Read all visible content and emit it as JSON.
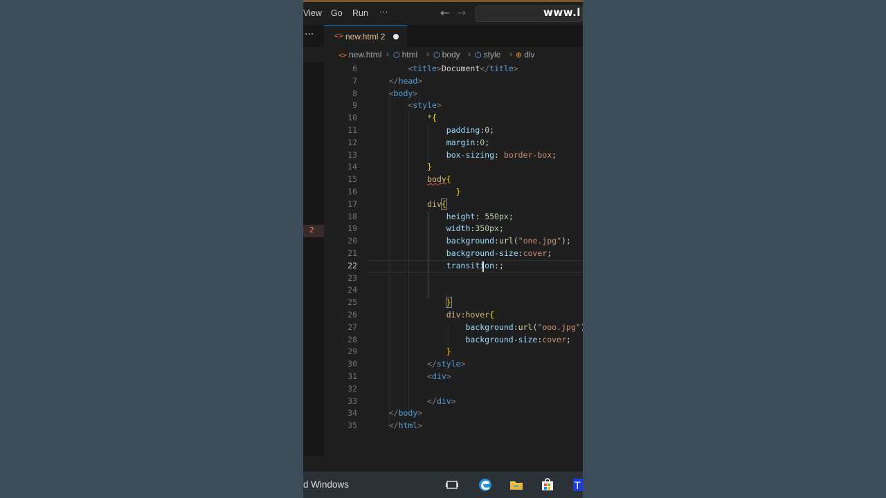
{
  "menu": {
    "items": [
      "View",
      "Go",
      "Run",
      "···"
    ],
    "back": "←",
    "forward": "→",
    "watermark": "www.l"
  },
  "tab": {
    "overflow": "···",
    "icon": "<>",
    "label": "new.html",
    "problems": "2"
  },
  "breadcrumb": {
    "items": [
      "new.html",
      "html",
      "body",
      "style",
      "div"
    ]
  },
  "gutter": {
    "error_count": "2"
  },
  "editor": {
    "current_line": 22,
    "lines": [
      {
        "n": "6",
        "html": "        <span class='t-tag'>&lt;</span><span class='t-name'>title</span><span class='t-tag'>&gt;</span><span class='t-text'>Document</span><span class='t-tag'>&lt;/</span><span class='t-name'>title</span><span class='t-tag'>&gt;</span>"
      },
      {
        "n": "7",
        "html": "    <span class='t-tag'>&lt;/</span><span class='t-name'>head</span><span class='t-tag'>&gt;</span>"
      },
      {
        "n": "8",
        "html": "    <span class='t-tag'>&lt;</span><span class='t-name'>body</span><span class='t-tag'>&gt;</span>"
      },
      {
        "n": "9",
        "html": "        <span class='t-tag'>&lt;</span><span class='t-name'>style</span><span class='t-tag'>&gt;</span>"
      },
      {
        "n": "10",
        "html": "            <span class='t-sel'>*</span><span class='t-brace'>{</span>"
      },
      {
        "n": "11",
        "html": "                <span class='t-prop'>padding</span><span class='t-punc'>:</span><span class='t-num'>0</span><span class='t-punc'>;</span>"
      },
      {
        "n": "12",
        "html": "                <span class='t-prop'>margin</span><span class='t-punc'>:</span><span class='t-num'>0</span><span class='t-punc'>;</span>"
      },
      {
        "n": "13",
        "html": "                <span class='t-prop'>box-sizing</span><span class='t-punc'>: </span><span class='t-val'>border-box</span><span class='t-punc'>;</span>"
      },
      {
        "n": "14",
        "html": "            <span class='t-brace'>}</span>"
      },
      {
        "n": "15",
        "html": "            <span class='t-sel t-err'>body</span><span class='t-brace'>{</span>"
      },
      {
        "n": "16",
        "html": "                  <span class='t-brace'>}</span>"
      },
      {
        "n": "17",
        "html": "            <span class='t-sel'>div</span><span class='t-brace bracket-match'>{</span>"
      },
      {
        "n": "18",
        "html": "                <span class='t-prop'>height</span><span class='t-punc'>: </span><span class='t-num'>550px</span><span class='t-punc'>;</span>"
      },
      {
        "n": "19",
        "html": "                <span class='t-prop'>width</span><span class='t-punc'>:</span><span class='t-num'>350px</span><span class='t-punc'>;</span>"
      },
      {
        "n": "20",
        "html": "                <span class='t-prop'>background</span><span class='t-punc'>:</span><span class='t-fn'>url</span><span class='t-punc'>(</span><span class='t-val'>\"one.jpg\"</span><span class='t-punc'>);</span>"
      },
      {
        "n": "21",
        "html": "                <span class='t-prop'>background-size</span><span class='t-punc'>:</span><span class='t-val'>cover</span><span class='t-punc'>;</span>"
      },
      {
        "n": "22",
        "html": "                <span class='t-prop'>transition</span><span class='t-punc'>:;</span>"
      },
      {
        "n": "23",
        "html": ""
      },
      {
        "n": "24",
        "html": ""
      },
      {
        "n": "25",
        "html": "                <span class='t-brace bracket-match'>}</span>"
      },
      {
        "n": "26",
        "html": "                <span class='t-sel'>div:hover</span><span class='t-brace'>{</span>"
      },
      {
        "n": "27",
        "html": "                    <span class='t-prop'>background</span><span class='t-punc'>:</span><span class='t-fn'>url</span><span class='t-punc'>(</span><span class='t-val'>\"ooo.jpg\"</span><span class='t-punc'>);</span>"
      },
      {
        "n": "28",
        "html": "                    <span class='t-prop'>background-size</span><span class='t-punc'>:</span><span class='t-val'>cover</span><span class='t-punc'>;</span>"
      },
      {
        "n": "29",
        "html": "                <span class='t-brace'>}</span>"
      },
      {
        "n": "30",
        "html": "            <span class='t-tag'>&lt;/</span><span class='t-name'>style</span><span class='t-tag'>&gt;</span>"
      },
      {
        "n": "31",
        "html": "            <span class='t-tag'>&lt;</span><span class='t-name'>div</span><span class='t-tag'>&gt;</span>"
      },
      {
        "n": "32",
        "html": ""
      },
      {
        "n": "33",
        "html": "            <span class='t-tag'>&lt;/</span><span class='t-name'>div</span><span class='t-tag'>&gt;</span>"
      },
      {
        "n": "34",
        "html": "    <span class='t-tag'>&lt;/</span><span class='t-name'>body</span><span class='t-tag'>&gt;</span>"
      },
      {
        "n": "35",
        "html": "    <span class='t-tag'>&lt;/</span><span class='t-name'>html</span><span class='t-tag'>&gt;</span>"
      }
    ]
  },
  "taskbar": {
    "text": "d Windows",
    "icons": [
      "task-view-icon",
      "edge-icon",
      "file-explorer-icon",
      "store-icon",
      "app-icon"
    ]
  },
  "colors": {
    "background": "#3b4a59",
    "editor_bg": "#1f1f1f",
    "accent": "#0078d4",
    "error": "#f14c4c"
  }
}
